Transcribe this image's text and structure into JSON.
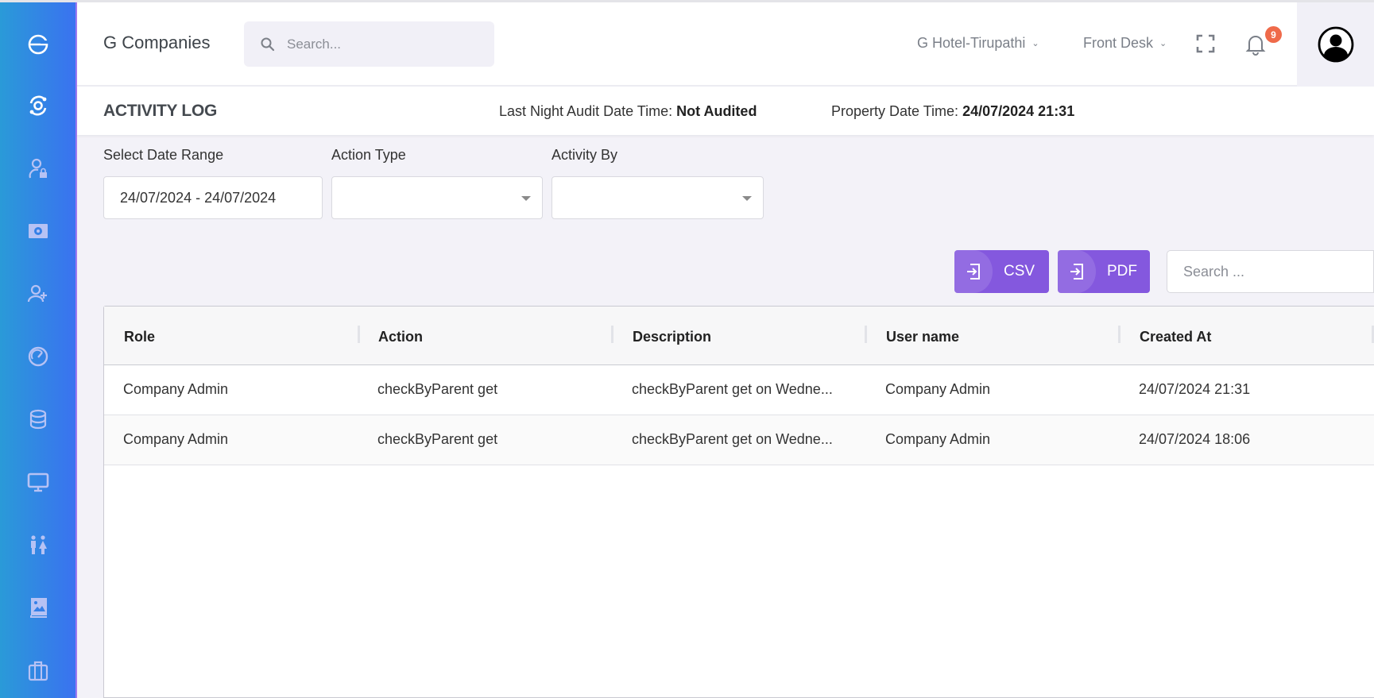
{
  "sidebar": {
    "items": [
      {
        "icon": "app-logo-icon",
        "active": true
      },
      {
        "icon": "dashboard-orbit-icon",
        "active": true
      },
      {
        "icon": "user-lock-icon",
        "active": false
      },
      {
        "icon": "money-bill-icon",
        "active": false
      },
      {
        "icon": "user-plus-icon",
        "active": false
      },
      {
        "icon": "gauge-icon",
        "active": false
      },
      {
        "icon": "database-icon",
        "active": false
      },
      {
        "icon": "monitor-icon",
        "active": false
      },
      {
        "icon": "restroom-icon",
        "active": false
      },
      {
        "icon": "photo-book-icon",
        "active": false
      },
      {
        "icon": "briefcase-icon",
        "active": false
      }
    ]
  },
  "header": {
    "company": "G Companies",
    "search_placeholder": "Search...",
    "property": "G Hotel-Tirupathi",
    "department": "Front Desk",
    "notifications_count": "9"
  },
  "titlebar": {
    "title": "ACTIVITY LOG",
    "audit_label": "Last Night Audit Date Time:",
    "audit_value": "Not Audited",
    "property_label": "Property Date Time:",
    "property_value": "24/07/2024 21:31"
  },
  "filters": {
    "date_range_label": "Select Date Range",
    "date_range_value": "24/07/2024 - 24/07/2024",
    "action_type_label": "Action Type",
    "action_type_value": "",
    "activity_by_label": "Activity By",
    "activity_by_value": ""
  },
  "toolbar": {
    "csv_label": "CSV",
    "pdf_label": "PDF",
    "search_placeholder": "Search ..."
  },
  "table": {
    "columns": [
      "Role",
      "Action",
      "Description",
      "User name",
      "Created At"
    ],
    "rows": [
      [
        "Company Admin",
        "checkByParent get",
        "checkByParent get on Wedne...",
        "Company Admin",
        "24/07/2024 21:31"
      ],
      [
        "Company Admin",
        "checkByParent get",
        "checkByParent get on Wedne...",
        "Company Admin",
        "24/07/2024 18:06"
      ]
    ]
  },
  "colors": {
    "accent": "#8458de",
    "badge": "#ef6a4a",
    "sidebar_start": "#2a9ad8",
    "sidebar_end": "#3a72f0"
  }
}
